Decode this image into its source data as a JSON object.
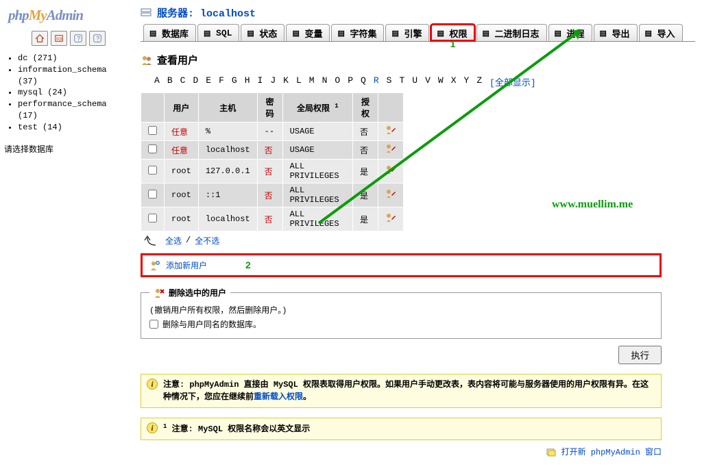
{
  "logo_parts": [
    "php",
    "My",
    "Admin"
  ],
  "server_prefix": "服务器: ",
  "server_name": "localhost",
  "databases": [
    {
      "name": "dc",
      "count": 271
    },
    {
      "name": "information_schema",
      "count": 37
    },
    {
      "name": "mysql",
      "count": 24
    },
    {
      "name": "performance_schema",
      "count": 17
    },
    {
      "name": "test",
      "count": 14
    }
  ],
  "side_prompt": "请选择数据库",
  "tabs": [
    "数据库",
    "SQL",
    "状态",
    "变量",
    "字符集",
    "引擎",
    "权限",
    "二进制日志",
    "进程",
    "导出",
    "导入"
  ],
  "highlight_tab_index": 6,
  "section_title": "查看用户",
  "alpha": [
    "A",
    "B",
    "C",
    "D",
    "E",
    "F",
    "G",
    "H",
    "I",
    "J",
    "K",
    "L",
    "M",
    "N",
    "O",
    "P",
    "Q",
    "R",
    "S",
    "T",
    "U",
    "V",
    "W",
    "X",
    "Y",
    "Z"
  ],
  "alpha_link": "R",
  "alpha_all": "[全部显示]",
  "table": {
    "headers": [
      "用户",
      "主机",
      "密码",
      "全局权限",
      "授权"
    ],
    "header_sup": "1",
    "rows": [
      {
        "user": "任意",
        "host": "%",
        "pw": "--",
        "priv": "USAGE",
        "grant": "否",
        "user_red": true,
        "pw_red": false
      },
      {
        "user": "任意",
        "host": "localhost",
        "pw": "否",
        "priv": "USAGE",
        "grant": "否",
        "user_red": true,
        "pw_red": true
      },
      {
        "user": "root",
        "host": "127.0.0.1",
        "pw": "否",
        "priv": "ALL PRIVILEGES",
        "grant": "是",
        "user_red": false,
        "pw_red": true
      },
      {
        "user": "root",
        "host": "::1",
        "pw": "否",
        "priv": "ALL PRIVILEGES",
        "grant": "是",
        "user_red": false,
        "pw_red": true
      },
      {
        "user": "root",
        "host": "localhost",
        "pw": "否",
        "priv": "ALL PRIVILEGES",
        "grant": "是",
        "user_red": false,
        "pw_red": true
      }
    ]
  },
  "select_all": "全选",
  "select_none": "全不选",
  "add_user": "添加新用户",
  "del_legend": "删除选中的用户",
  "del_desc": "(撤销用户所有权限，然后删除用户。)",
  "del_chk_label": "删除与用户同名的数据库。",
  "exec_btn": "执行",
  "note1_a": "注意: phpMyAdmin 直接由 MySQL 权限表取得用户权限。如果用户手动更改表，表内容将可能与服务器使用的用户权限有异。在这种情况下，您应在继续前",
  "note1_link": "重新载入权限",
  "note1_b": "。",
  "note2": "注意: MySQL 权限名称会以英文显示",
  "note2_sup": "1",
  "newwin": "打开新 phpMyAdmin 窗口",
  "watermark": "www.muellim.me",
  "mark1": "1",
  "mark2": "2",
  "slash": "/"
}
